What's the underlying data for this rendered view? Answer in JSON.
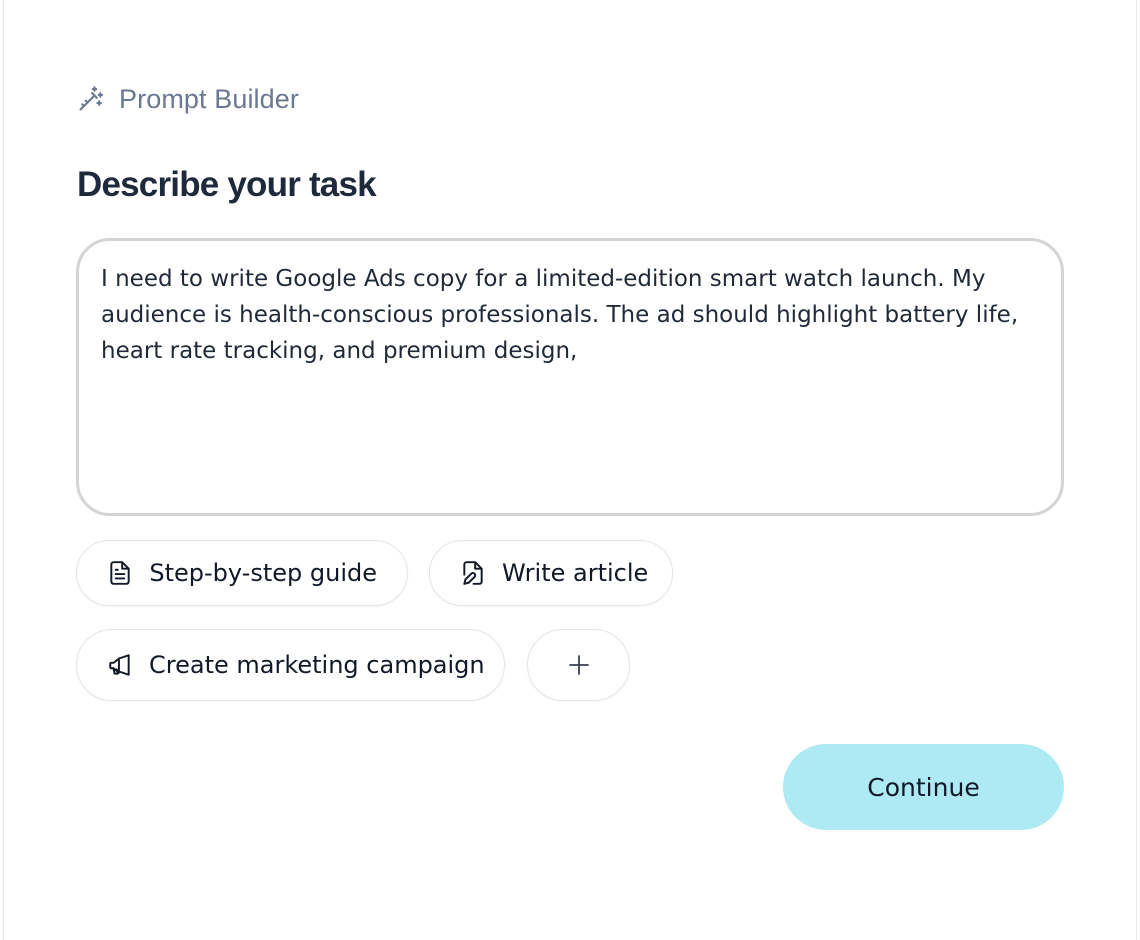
{
  "header": {
    "icon": "magic-wand-icon",
    "label": "Prompt Builder"
  },
  "task": {
    "heading": "Describe your task",
    "value": "I need to write Google Ads copy for a limited-edition smart watch launch. My audience is health-conscious professionals. The ad should highlight battery life, heart rate tracking, and premium design,"
  },
  "suggestions": [
    {
      "label": "Step-by-step guide",
      "icon": "document-icon"
    },
    {
      "label": "Write article",
      "icon": "file-edit-icon"
    },
    {
      "label": "Create marketing campaign",
      "icon": "megaphone-icon"
    }
  ],
  "add_button": {
    "label": "+",
    "icon": "plus-icon"
  },
  "continue_button": {
    "label": "Continue"
  },
  "colors": {
    "accent": "#aeeaf4",
    "muted_text": "#6b7891",
    "heading": "#1e293b"
  }
}
